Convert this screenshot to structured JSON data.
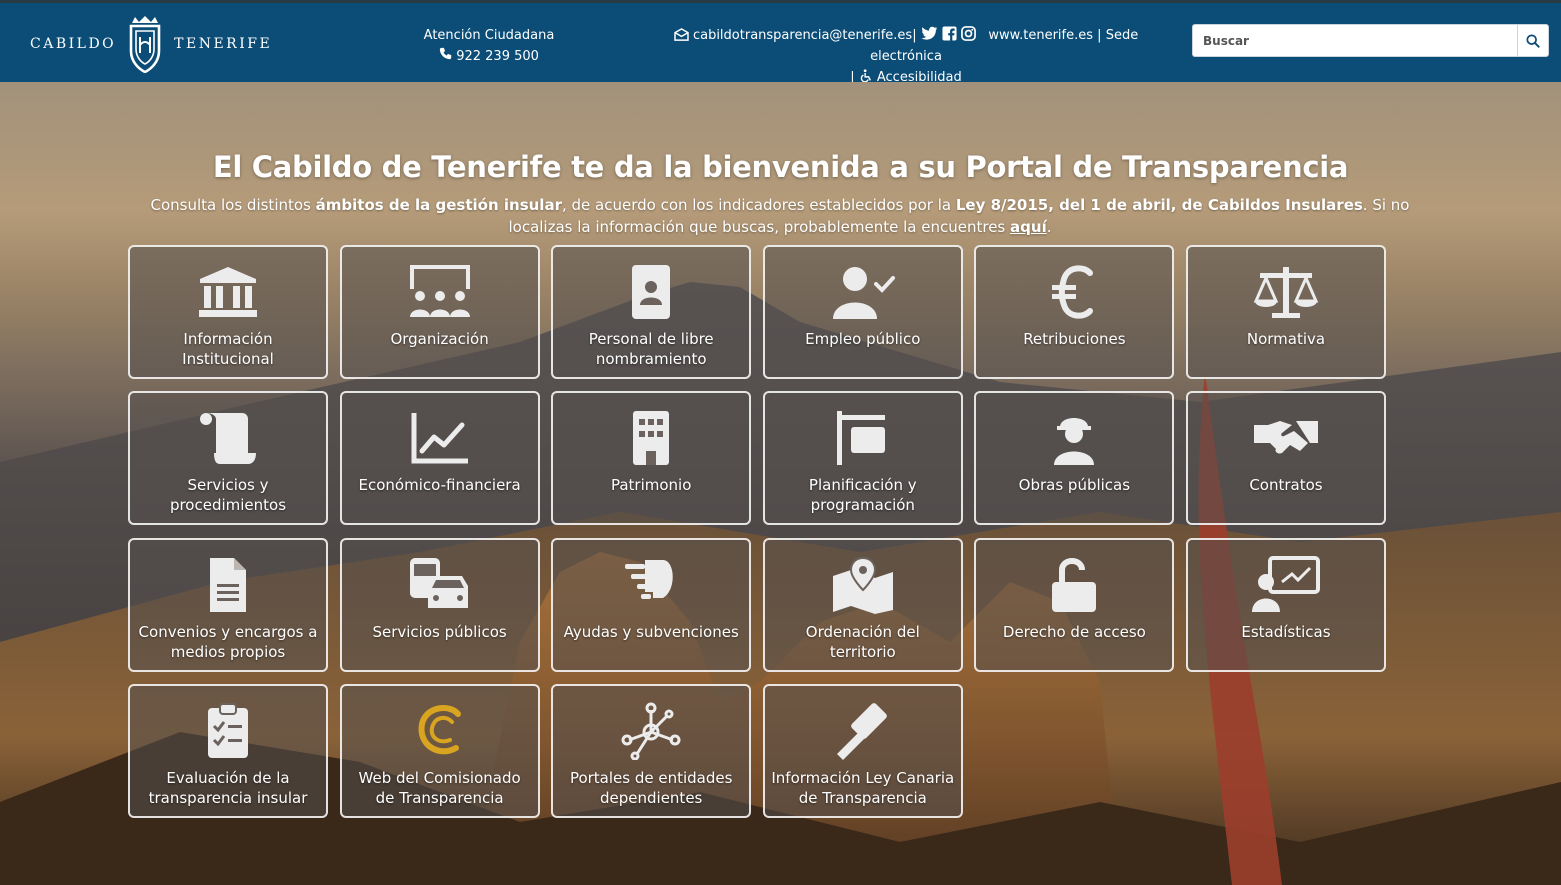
{
  "header": {
    "logo": {
      "word_left": "CABILDO",
      "word_right": "TENERIFE"
    },
    "atencion_title": "Atención Ciudadana",
    "phone": "922 239 500",
    "email": "cabildotransparencia@tenerife.es",
    "sep1": "|",
    "website": "www.tenerife.es",
    "sep2": "|",
    "sede": "Sede electrónica",
    "sep3": "|",
    "accesibilidad": "Accesibilidad",
    "search_placeholder": "Buscar"
  },
  "hero": {
    "title": "El Cabildo de Tenerife te da la bienvenida a su Portal de Transparencia",
    "intro_1": "Consulta los distintos ",
    "intro_bold_1": "ámbitos de la gestión insular",
    "intro_2": ", de acuerdo con los indicadores establecidos por la ",
    "intro_bold_2": "Ley 8/2015, del 1 de abril, de Cabildos Insulares",
    "intro_3": ". Si no localizas la información que buscas, probablemente la encuentres ",
    "intro_link": "aquí",
    "intro_4": "."
  },
  "tiles": [
    {
      "label": "Información Institucional",
      "icon": "institution-icon"
    },
    {
      "label": "Organización",
      "icon": "organization-icon"
    },
    {
      "label": "Personal de libre nombramiento",
      "icon": "badge-icon"
    },
    {
      "label": "Empleo público",
      "icon": "user-check-icon"
    },
    {
      "label": "Retribuciones",
      "icon": "euro-icon"
    },
    {
      "label": "Normativa",
      "icon": "scales-icon"
    },
    {
      "label": "Servicios y procedimientos",
      "icon": "scroll-icon"
    },
    {
      "label": "Económico-financiera",
      "icon": "chart-line-icon"
    },
    {
      "label": "Patrimonio",
      "icon": "building-icon"
    },
    {
      "label": "Planificación y programación",
      "icon": "sign-icon"
    },
    {
      "label": "Obras públicas",
      "icon": "worker-icon"
    },
    {
      "label": "Contratos",
      "icon": "handshake-icon"
    },
    {
      "label": "Convenios y encargos a medios propios",
      "icon": "file-icon"
    },
    {
      "label": "Servicios públicos",
      "icon": "bus-car-icon"
    },
    {
      "label": "Ayudas y subvenciones",
      "icon": "hand-holding-icon"
    },
    {
      "label": "Ordenación del territorio",
      "icon": "map-marker-icon"
    },
    {
      "label": "Derecho de acceso",
      "icon": "unlock-icon"
    },
    {
      "label": "Estadísticas",
      "icon": "presentation-icon"
    },
    {
      "label": "Evaluación de la transparencia insular",
      "icon": "clipboard-check-icon"
    },
    {
      "label": "Web del Comisionado de Transparencia",
      "icon": "comisionado-logo-icon"
    },
    {
      "label": "Portales de entidades dependientes",
      "icon": "network-icon"
    },
    {
      "label": "Información Ley Canaria de Transparencia",
      "icon": "gavel-icon"
    }
  ],
  "colors": {
    "header_bg": "#0b4d77",
    "icon_light": "#ececec",
    "comisionado_gold": "#d9a520"
  }
}
